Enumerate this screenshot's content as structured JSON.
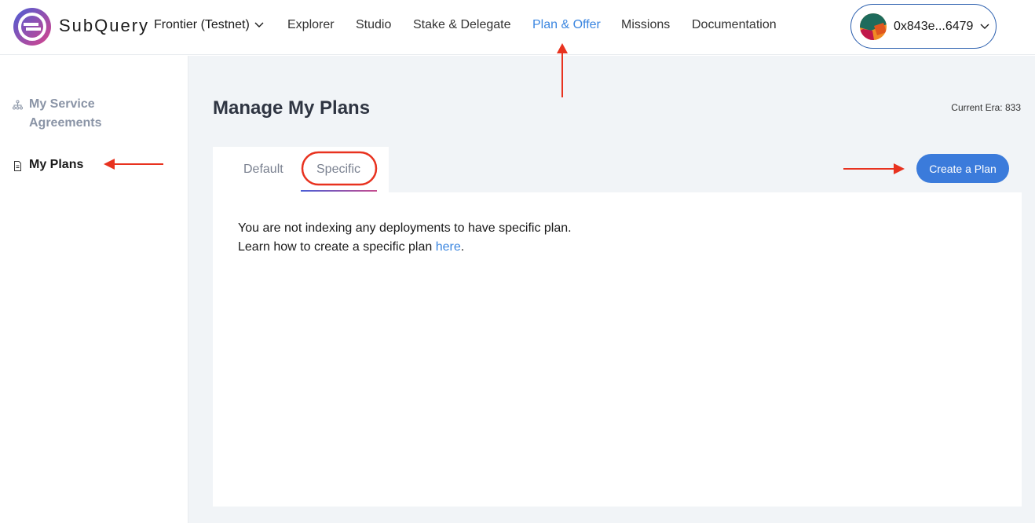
{
  "brand": {
    "name": "SubQuery"
  },
  "network": {
    "label": "Frontier (Testnet)"
  },
  "nav": {
    "explorer": "Explorer",
    "studio": "Studio",
    "stake": "Stake & Delegate",
    "plan": "Plan & Offer",
    "missions": "Missions",
    "docs": "Documentation"
  },
  "wallet": {
    "address": "0x843e...6479"
  },
  "sidebar": {
    "service_line1": "My Service",
    "service_line2": "Agreements",
    "plans": "My Plans"
  },
  "page": {
    "title": "Manage My Plans",
    "era": "Current Era: 833"
  },
  "tabs": {
    "default": "Default",
    "specific": "Specific"
  },
  "actions": {
    "create": "Create a Plan"
  },
  "message": {
    "line1": "You are not indexing any deployments to have specific plan.",
    "line2_prefix": "Learn how to create a specific plan ",
    "link": "here",
    "line2_suffix": "."
  },
  "colors": {
    "accent": "#3b86e0",
    "button": "#3b7bdb",
    "annotation": "#e8321f"
  }
}
